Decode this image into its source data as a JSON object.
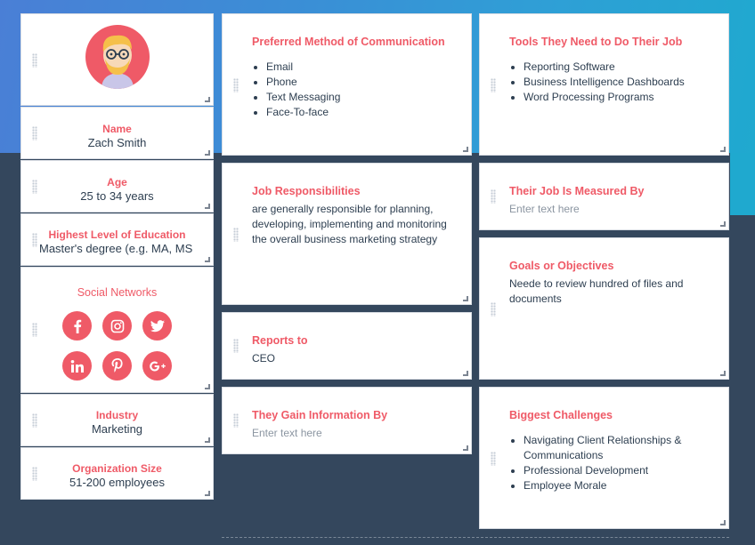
{
  "profile": {
    "name_label": "Name",
    "name_value": "Zach Smith",
    "age_label": "Age",
    "age_value": "25 to 34 years",
    "education_label": "Highest Level of Education",
    "education_value": "Master's degree (e.g. MA, MS",
    "social_label": "Social Networks",
    "social_icons": [
      "facebook-icon",
      "instagram-icon",
      "twitter-icon",
      "linkedin-icon",
      "pinterest-icon",
      "google-plus-icon"
    ],
    "industry_label": "Industry",
    "industry_value": "Marketing",
    "org_size_label": "Organization Size",
    "org_size_value": "51-200 employees"
  },
  "communication": {
    "title": "Preferred Method of Communication",
    "items": [
      "Email",
      "Phone",
      "Text Messaging",
      "Face-To-face"
    ]
  },
  "tools": {
    "title": "Tools They Need to Do Their Job",
    "items": [
      "Reporting Software",
      "Business Intelligence Dashboards",
      "Word Processing Programs"
    ]
  },
  "responsibilities": {
    "title": "Job Responsibilities",
    "text": "are generally responsible for planning, developing, implementing and monitoring the overall business marketing strategy"
  },
  "measured": {
    "title": "Their Job Is Measured By",
    "placeholder": "Enter text here"
  },
  "goals": {
    "title": "Goals or Objectives",
    "text": "Neede to review hundred of files and documents"
  },
  "reports": {
    "title": "Reports to",
    "text": "CEO"
  },
  "gain_info": {
    "title": "They Gain Information By",
    "placeholder": "Enter text here"
  },
  "challenges": {
    "title": "Biggest Challenges",
    "items": [
      "Navigating Client Relationships & Communications",
      "Professional Development",
      "Employee Morale"
    ]
  },
  "colors": {
    "accent": "#ef5a67",
    "text": "#2d3e50",
    "background": "#34475d"
  }
}
